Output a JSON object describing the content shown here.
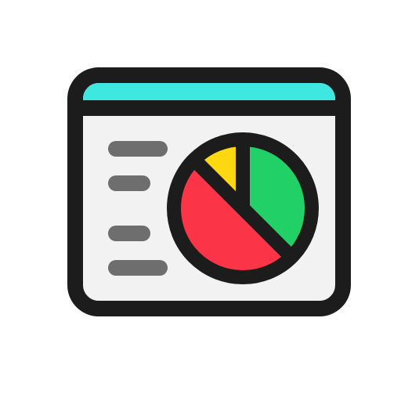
{
  "icon": {
    "name": "dashboard-window-icon",
    "description_free": true,
    "colors": {
      "outline": "#1c1c1c",
      "title_bar": "#3ee8e0",
      "window_body": "#f2f2f2",
      "text_lines": "#6e6e6e",
      "pie_large": "#fc3448",
      "pie_medium": "#21d066",
      "pie_small": "#fdd710"
    },
    "pie_chart": {
      "slices": [
        {
          "name": "red",
          "fraction": 0.5
        },
        {
          "name": "green",
          "fraction": 0.375
        },
        {
          "name": "yellow",
          "fraction": 0.125
        }
      ]
    },
    "text_lines_count": 4
  }
}
